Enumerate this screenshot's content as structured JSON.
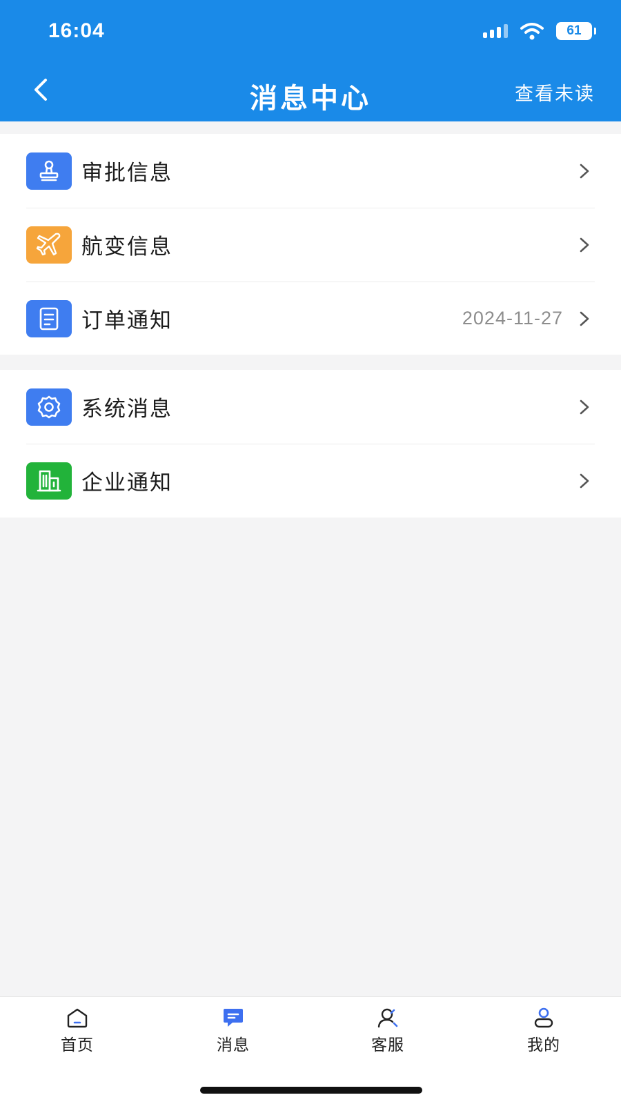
{
  "status_bar": {
    "time": "16:04",
    "battery": "61"
  },
  "header": {
    "title": "消息中心",
    "action_label": "查看未读"
  },
  "groups": [
    {
      "items": [
        {
          "label": "审批信息",
          "icon": "stamp-icon",
          "color": "#3f7df0",
          "date": ""
        },
        {
          "label": "航变信息",
          "icon": "airplane-icon",
          "color": "#f6a53b",
          "date": ""
        },
        {
          "label": "订单通知",
          "icon": "document-icon",
          "color": "#3f7df0",
          "date": "2024-11-27"
        }
      ]
    },
    {
      "items": [
        {
          "label": "系统消息",
          "icon": "gear-icon",
          "color": "#3f7df0",
          "date": ""
        },
        {
          "label": "企业通知",
          "icon": "building-icon",
          "color": "#22b33a",
          "date": ""
        }
      ]
    }
  ],
  "tabs": [
    {
      "label": "首页",
      "icon": "home-icon",
      "active": false
    },
    {
      "label": "消息",
      "icon": "message-icon",
      "active": true
    },
    {
      "label": "客服",
      "icon": "customer-service-icon",
      "active": false
    },
    {
      "label": "我的",
      "icon": "profile-icon",
      "active": false
    }
  ],
  "colors": {
    "primary": "#1a8ae8",
    "active_tab": "#3d6ff0",
    "background": "#f4f4f5"
  }
}
